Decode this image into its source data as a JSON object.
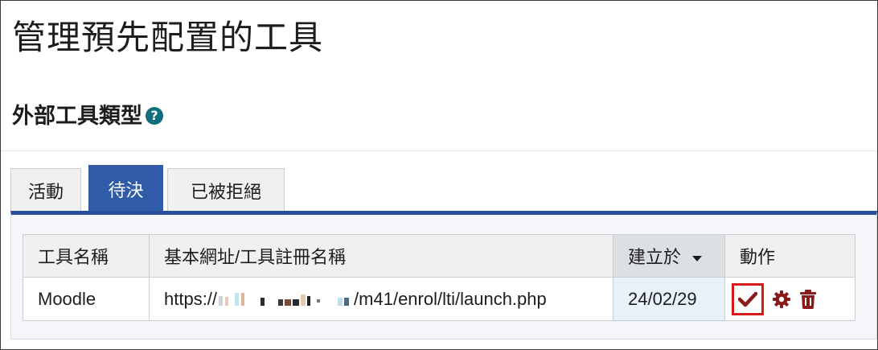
{
  "page": {
    "title": "管理預先配置的工具",
    "section_heading": "外部工具類型",
    "help_glyph": "?"
  },
  "tabs": [
    {
      "label": "活動"
    },
    {
      "label": "待決",
      "active": true
    },
    {
      "label": "已被拒絕"
    }
  ],
  "table": {
    "headers": {
      "name": "工具名稱",
      "url": "基本網址/工具註冊名稱",
      "created": "建立於",
      "actions": "動作"
    },
    "rows": [
      {
        "name": "Moodle",
        "url_prefix": "https://",
        "url_suffix": "/m41/enrol/lti/launch.php",
        "created": "24/02/29"
      }
    ]
  },
  "icons": {
    "help": "question-circle-icon",
    "sort": "caret-down-icon",
    "accept": "check-icon",
    "settings": "gear-icon",
    "delete": "trash-icon"
  },
  "colors": {
    "active_tab": "#2f5ba8",
    "panel_border": "#2a4f9a",
    "action_icon": "#8b1a1a",
    "help_icon": "#0f6e7e",
    "highlight": "#d51a1a"
  }
}
